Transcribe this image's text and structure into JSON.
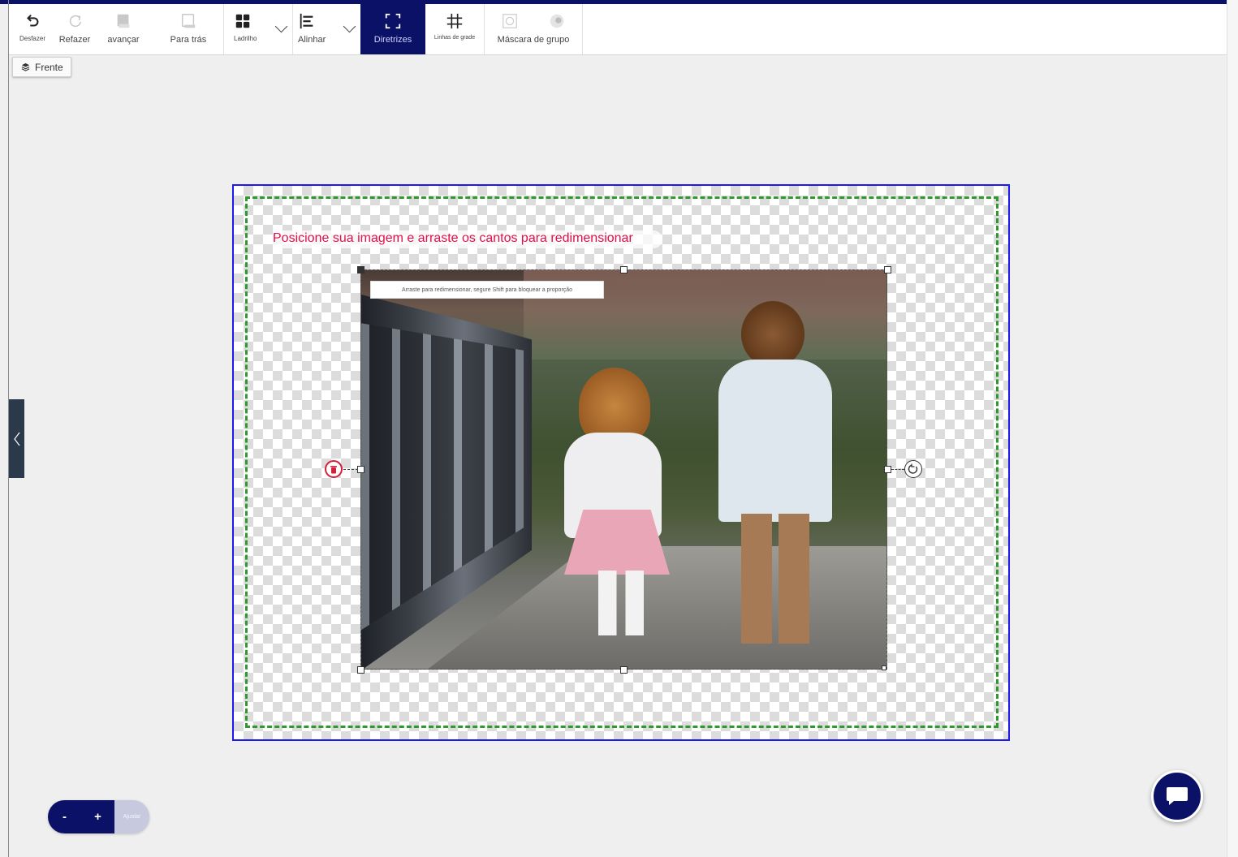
{
  "toolbar": {
    "undo_label": "Desfazer",
    "redo_label": "Refazer",
    "forward_label": "avançar",
    "back_label": "Para trás",
    "tile_label": "Ladrilho",
    "align_label": "Alinhar",
    "guides_label": "Diretrizes",
    "gridlines_label": "Linhas de grade",
    "group_mask_label": "Máscara de grupo"
  },
  "layer_chip": {
    "label": "Frente"
  },
  "canvas": {
    "hint": "Posicione sua imagem e arraste os cantos para redimensionar",
    "image_tooltip": "Arraste para redimensionar, segure Shift para bloquear a proporção"
  },
  "zoom": {
    "minus": "-",
    "plus": "+",
    "fit": "Ajustar"
  },
  "colors": {
    "accent": "#0b1166",
    "guide_green": "#2e9a2e",
    "frame_blue": "#1b1bf0",
    "hint_red": "#e0104a"
  }
}
